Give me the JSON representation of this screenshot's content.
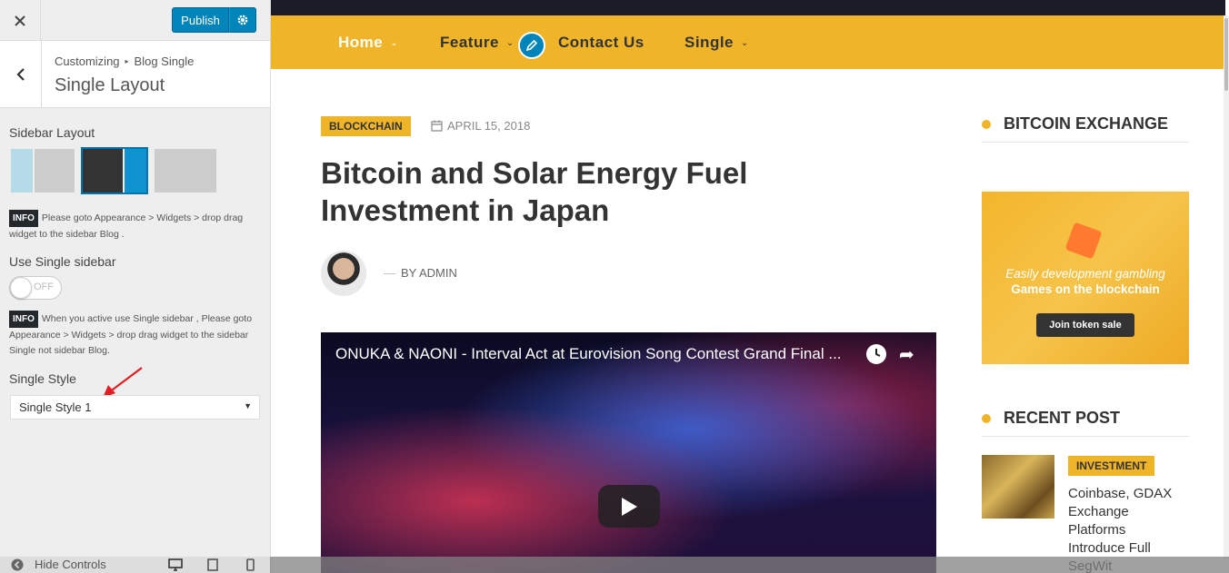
{
  "customizer": {
    "publish_label": "Publish",
    "breadcrumb": {
      "root": "Customizing",
      "current": "Blog Single"
    },
    "section_title": "Single Layout",
    "sidebar_layout_label": "Sidebar Layout",
    "info_badge": "INFO",
    "info_1": "Please goto Appearance > Widgets > drop drag widget to the sidebar Blog .",
    "use_single_sidebar_label": "Use Single sidebar",
    "toggle_state": "OFF",
    "info_2": "When you active use Single sidebar , Please goto Appearance > Widgets > drop drag widget to the sidebar Single not sidebar Blog.",
    "single_style_label": "Single Style",
    "single_style_value": "Single Style 1",
    "hide_controls_label": "Hide Controls",
    "accent_color": "#0085ba"
  },
  "site": {
    "nav": [
      {
        "label": "Home"
      },
      {
        "label": "Feature"
      },
      {
        "label": "Contact Us"
      },
      {
        "label": "Single"
      }
    ],
    "brand_color": "#f0b429",
    "post": {
      "category": "BLOCKCHAIN",
      "date": "APRIL 15, 2018",
      "title": "Bitcoin and Solar Energy Fuel Investment in Japan",
      "author": "BY ADMIN",
      "author_dash": "—",
      "video_title": "ONUKA & NAONI - Interval Act at Eurovision Song Contest Grand Final ..."
    },
    "sidebar": {
      "widget1_title": "BITCOIN EXCHANGE",
      "ad_line1": "Easily development gambling",
      "ad_line2": "Games on the blockchain",
      "ad_button": "Join token sale",
      "widget2_title": "RECENT POST",
      "recent_post": {
        "category": "INVESTMENT",
        "title": "Coinbase, GDAX Exchange Platforms Introduce Full SegWit"
      }
    }
  }
}
